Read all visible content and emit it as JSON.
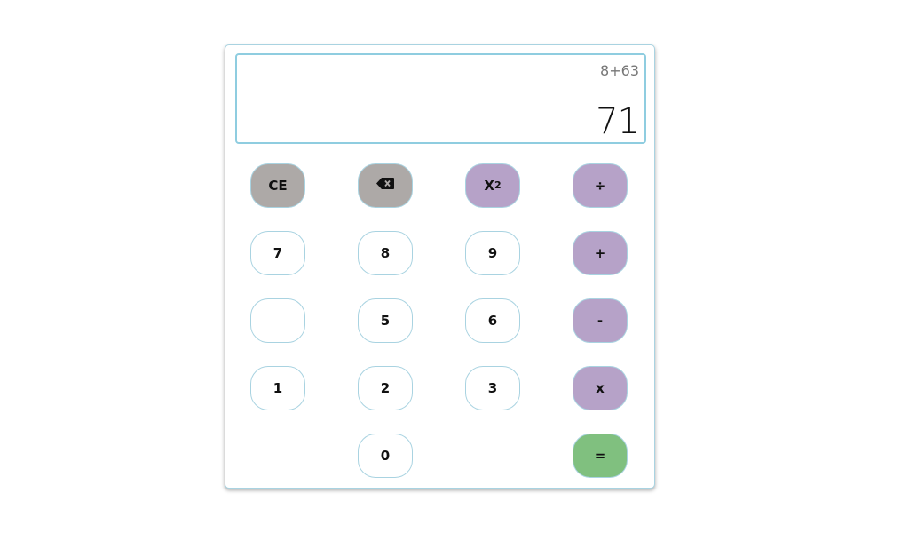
{
  "display": {
    "expression": "8+63",
    "result": "71"
  },
  "keys": {
    "ce": "CE",
    "square": "X",
    "square_exp": "2",
    "divide": "÷",
    "seven": "7",
    "eight": "8",
    "nine": "9",
    "plus": "+",
    "minus": "-",
    "five": "5",
    "six": "6",
    "one": "1",
    "two": "2",
    "three": "3",
    "multiply": "x",
    "zero": "0",
    "equals": "="
  },
  "icons": {
    "backspace": "backspace-icon"
  },
  "colors": {
    "control": "#ada9a7",
    "operator": "#b6a2c8",
    "equals": "#80c07f",
    "border": "#a9d3e1"
  }
}
